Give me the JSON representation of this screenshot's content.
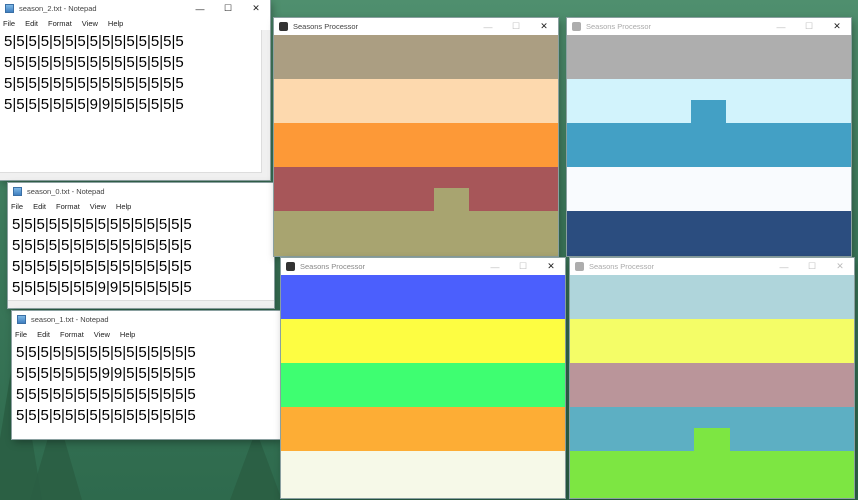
{
  "colors": {
    "autumn": [
      "#ab9e82",
      "#fdd9ae",
      "#fd9937",
      "#a75659",
      "#a8a470"
    ],
    "autumn_block": "#a8a470",
    "winter": [
      "#aeaeae",
      "#d2f3fc",
      "#43a0c5",
      "#f9fbfe",
      "#2b4d7f"
    ],
    "winter_block": "#43a0c5",
    "spring": [
      "#4b5ffd",
      "#fdfd42",
      "#3efe71",
      "#fdad35",
      "#f6f9e8"
    ],
    "summer": [
      "#afd5db",
      "#f4fd67",
      "#ba959a",
      "#5dafc3",
      "#7de642"
    ],
    "summer_block": "#7de642"
  },
  "notepads": [
    {
      "title": "season_2.txt - Notepad",
      "lines": [
        "5|5|5|5|5|5|5|5|5|5|5|5|5|5|5",
        "5|5|5|5|5|5|5|5|5|5|5|5|5|5|5",
        "5|5|5|5|5|5|5|5|5|5|5|5|5|5|5",
        "5|5|5|5|5|5|5|9|9|5|5|5|5|5|5"
      ]
    },
    {
      "title": "season_0.txt - Notepad",
      "lines": [
        "5|5|5|5|5|5|5|5|5|5|5|5|5|5|5",
        "5|5|5|5|5|5|5|5|5|5|5|5|5|5|5",
        "5|5|5|5|5|5|5|5|5|5|5|5|5|5|5",
        "5|5|5|5|5|5|5|9|9|5|5|5|5|5|5"
      ]
    },
    {
      "title": "season_1.txt - Notepad",
      "lines": [
        "5|5|5|5|5|5|5|5|5|5|5|5|5|5|5",
        "5|5|5|5|5|5|5|9|9|5|5|5|5|5|5",
        "5|5|5|5|5|5|5|5|5|5|5|5|5|5|5",
        "5|5|5|5|5|5|5|5|5|5|5|5|5|5|5"
      ]
    }
  ],
  "menu": [
    "File",
    "Edit",
    "Format",
    "View",
    "Help"
  ],
  "processor_title": "Seasons Processor",
  "controls": {
    "minimize": "—",
    "maximize": "☐",
    "close": "✕"
  }
}
